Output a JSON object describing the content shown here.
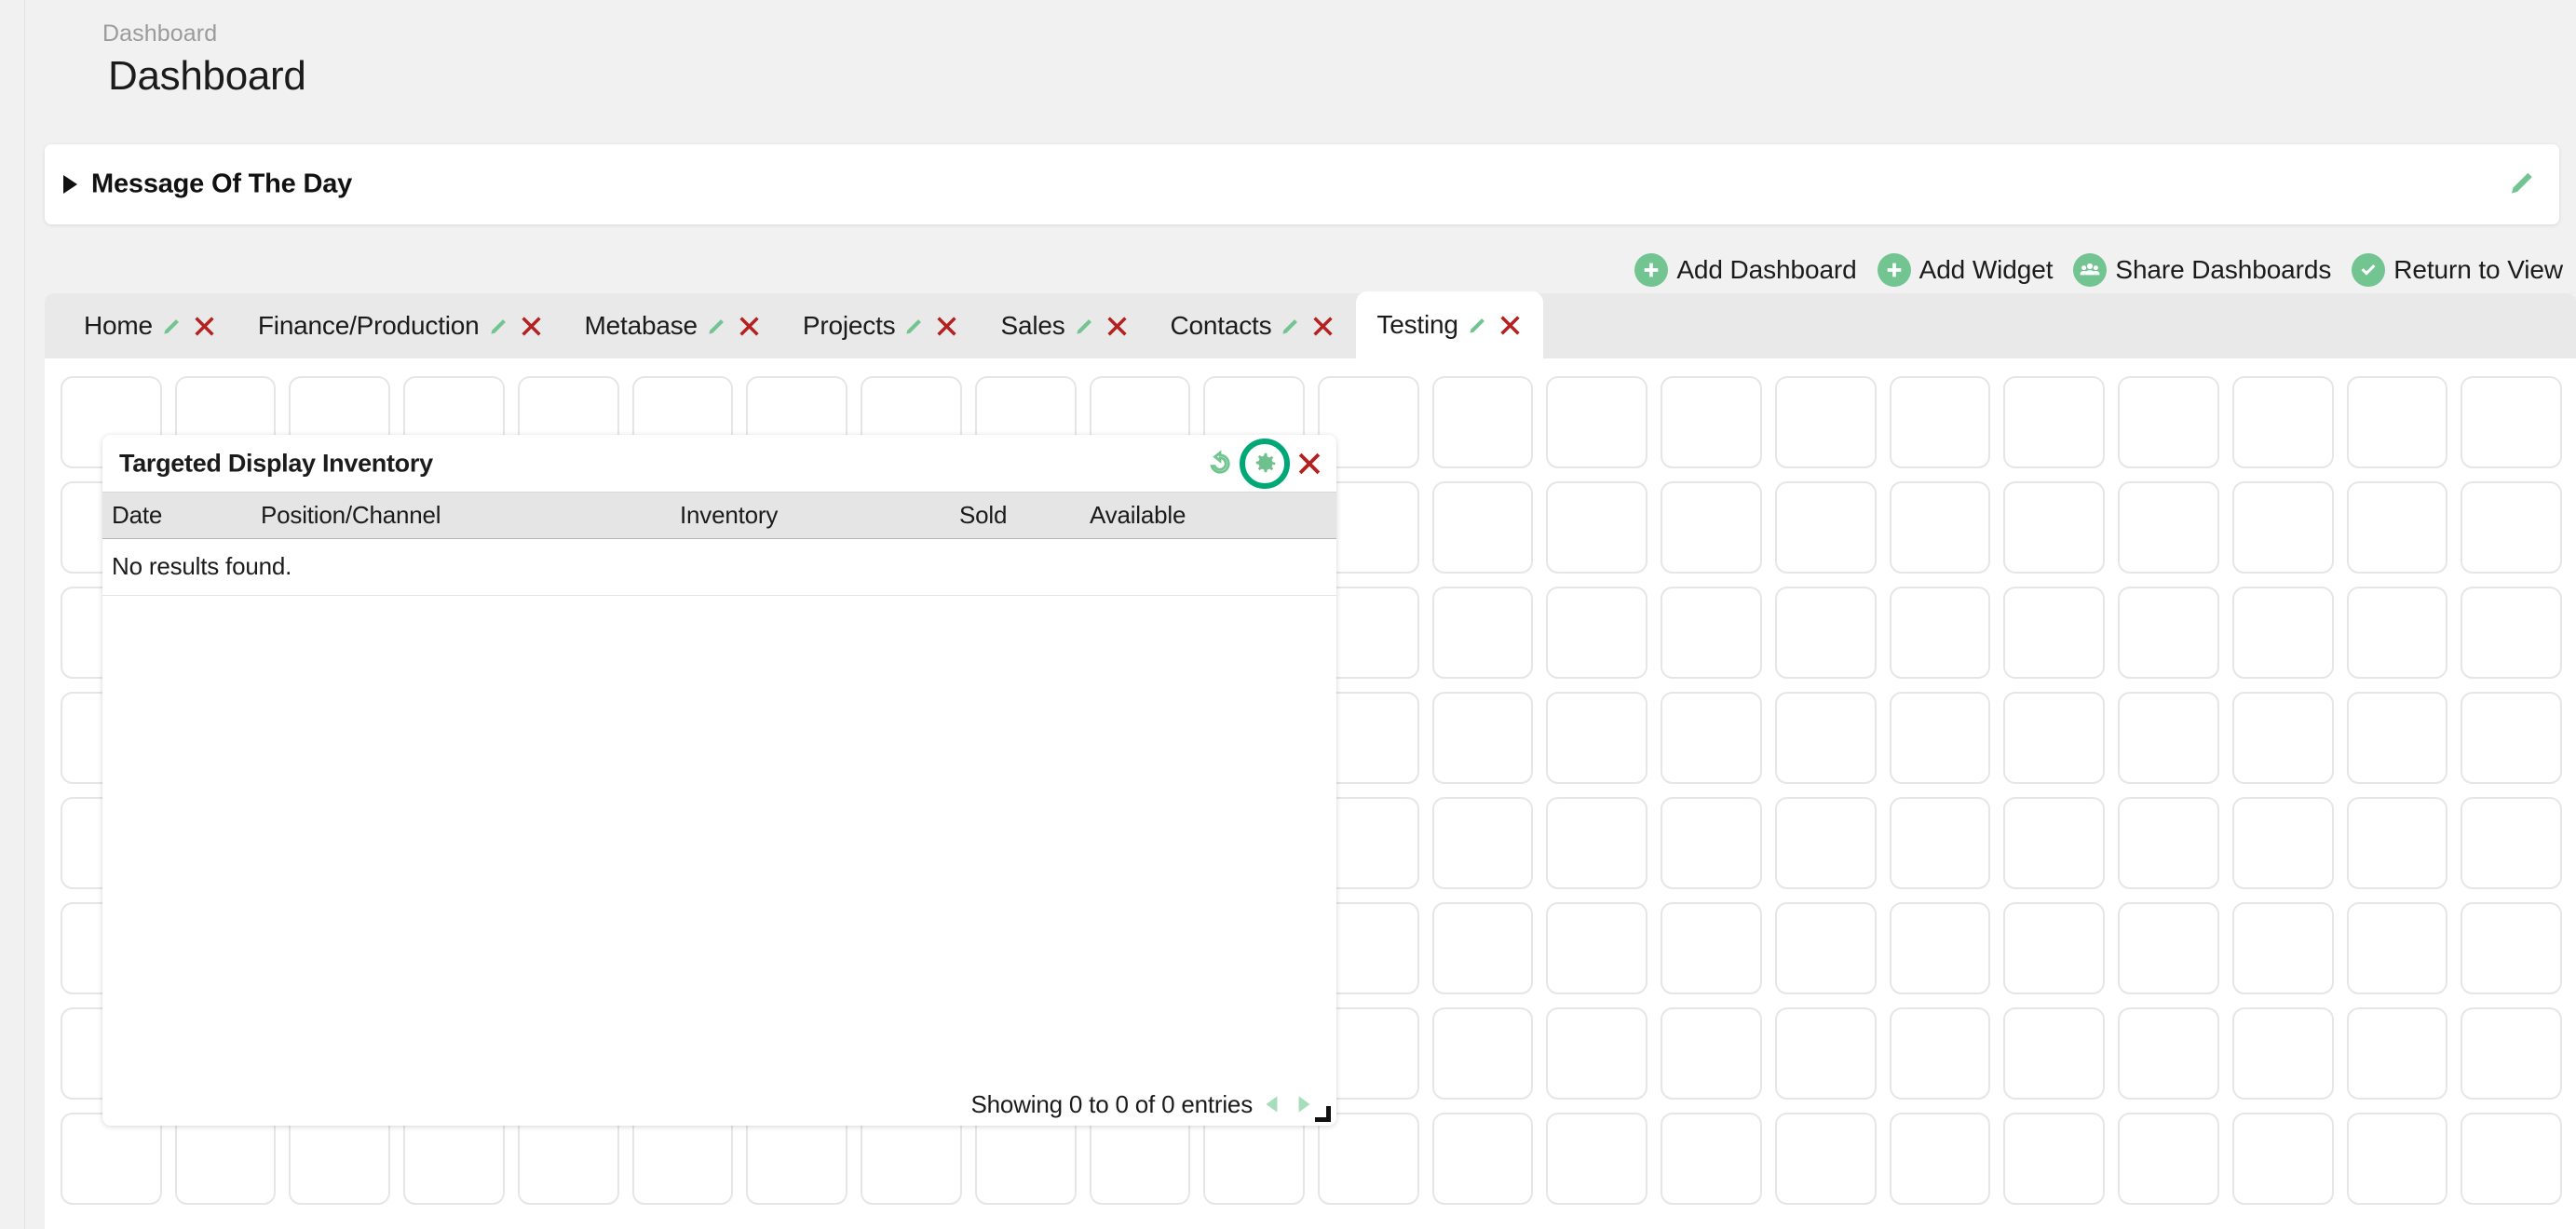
{
  "breadcrumb": "Dashboard",
  "page_title": "Dashboard",
  "motd": {
    "title": "Message Of The Day",
    "expand_icon": "triangle-right-icon",
    "edit_icon": "pencil-icon"
  },
  "toolbar": {
    "actions": [
      {
        "label": "Add Dashboard",
        "icon": "plus-circle-icon"
      },
      {
        "label": "Add Widget",
        "icon": "plus-circle-icon"
      },
      {
        "label": "Share Dashboards",
        "icon": "users-circle-icon"
      },
      {
        "label": "Return to View",
        "icon": "check-circle-icon"
      }
    ]
  },
  "tabs": [
    {
      "label": "Home",
      "active": false
    },
    {
      "label": "Finance/Production",
      "active": false
    },
    {
      "label": "Metabase",
      "active": false
    },
    {
      "label": "Projects",
      "active": false
    },
    {
      "label": "Sales",
      "active": false
    },
    {
      "label": "Contacts",
      "active": false
    },
    {
      "label": "Testing",
      "active": true
    }
  ],
  "widget": {
    "title": "Targeted Display Inventory",
    "tools": [
      {
        "name": "refresh-icon"
      },
      {
        "name": "gear-icon",
        "highlighted": true
      },
      {
        "name": "close-icon"
      }
    ],
    "table": {
      "columns": [
        "Date",
        "Position/Channel",
        "Inventory",
        "Sold",
        "Available"
      ],
      "rows": [],
      "empty_message": "No results found."
    },
    "footer": {
      "entries_text": "Showing 0 to 0 of 0 entries",
      "prev_icon": "triangle-left-icon",
      "next_icon": "triangle-right-icon",
      "resize_icon": "resize-handle-icon"
    }
  },
  "colors": {
    "accent_green": "#72c490",
    "highlight_ring": "#00a878",
    "danger_red": "#b32121",
    "page_bg": "#f1f1f1",
    "tabbar_bg": "#e9e9e9",
    "table_header_bg": "#e5e5e5"
  },
  "grid": {
    "columns": 22,
    "rows": 8,
    "cell_placeholder": ""
  }
}
